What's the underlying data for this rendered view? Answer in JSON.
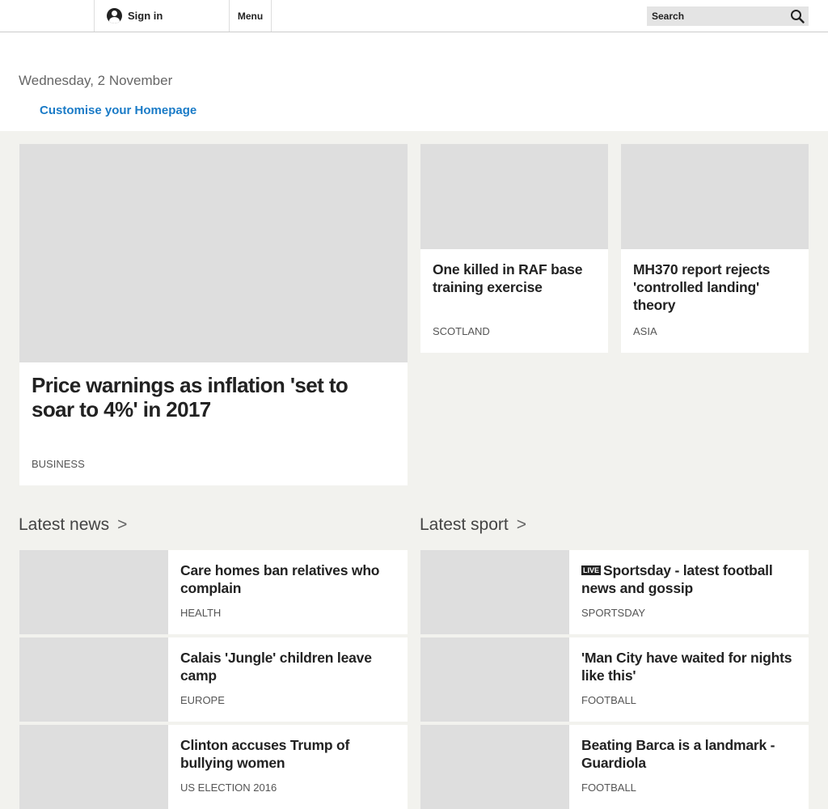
{
  "header": {
    "sign_in_label": "Sign in",
    "menu_label": "Menu",
    "search_placeholder": "Search"
  },
  "date_text": "Wednesday, 2 November",
  "customise_label": "Customise your Homepage",
  "top_stories": {
    "lead": {
      "title": "Price warnings as inflation 'set to soar to 4%' in 2017",
      "tag": "BUSINESS"
    },
    "side": [
      {
        "title": "One killed in RAF base training exercise",
        "tag": "SCOTLAND"
      },
      {
        "title": "MH370 report rejects 'controlled landing' theory",
        "tag": "ASIA"
      }
    ]
  },
  "latest_news": {
    "heading": "Latest news",
    "chevron": ">",
    "items": [
      {
        "title": "Care homes ban relatives who complain",
        "tag": "HEALTH"
      },
      {
        "title": "Calais 'Jungle' children leave camp",
        "tag": "EUROPE"
      },
      {
        "title": "Clinton accuses Trump of bullying women",
        "tag": "US ELECTION 2016"
      }
    ]
  },
  "latest_sport": {
    "heading": "Latest sport",
    "chevron": ">",
    "items": [
      {
        "badge": "LIVE",
        "title": "Sportsday - latest football news and gossip",
        "tag": "SPORTSDAY"
      },
      {
        "title": "'Man City have waited for nights like this'",
        "tag": "FOOTBALL"
      },
      {
        "title": "Beating Barca is a landmark - Guardiola",
        "tag": "FOOTBALL"
      }
    ]
  },
  "colors": {
    "link_blue": "#1a7bc7",
    "page_bg": "#f2f2ee",
    "placeholder_grey": "#dedede"
  }
}
